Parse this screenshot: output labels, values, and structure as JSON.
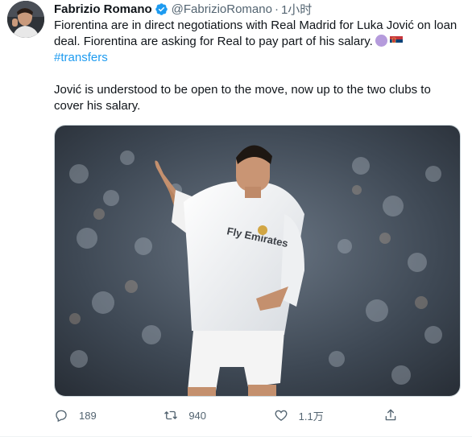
{
  "tweet": {
    "author_name": "Fabrizio Romano",
    "author_handle": "@FabrizioRomano",
    "separator": "·",
    "time": "1小时",
    "text_line1": "Fiorentina are in direct negotiations with Real Madrid for Luka Jović on loan deal. Fiorentina are asking for Real to pay part of his salary.",
    "hashtag": "#transfers",
    "text_line2": "Jović is understood to be open to the move, now up to the two clubs to cover his salary.",
    "jersey_sponsor": "Fly Emirates"
  },
  "actions": {
    "reply_count": "189",
    "retweet_count": "940",
    "like_count": "1.1万"
  },
  "icons": {
    "verified": "verified-badge-icon",
    "reply": "reply-icon",
    "retweet": "retweet-icon",
    "like": "heart-icon",
    "share": "share-icon"
  },
  "colors": {
    "accent": "#1d9bf0",
    "secondary_text": "#536471",
    "text": "#0f1419"
  }
}
